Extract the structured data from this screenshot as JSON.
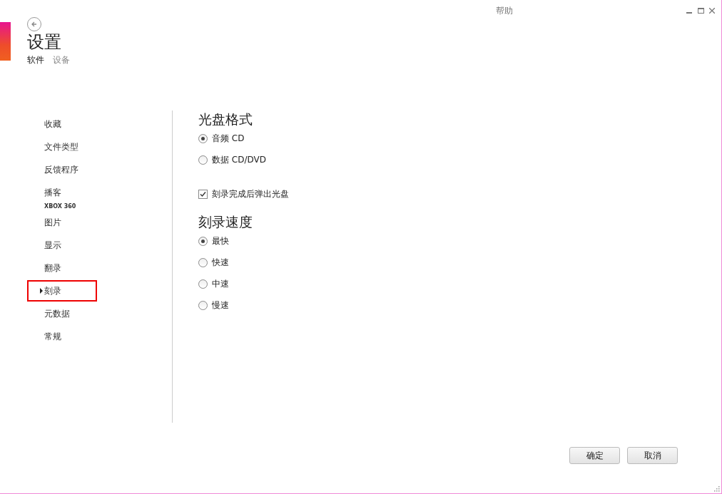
{
  "window": {
    "help": "帮助"
  },
  "header": {
    "title": "设置",
    "tabs": [
      {
        "label": "软件",
        "selected": true
      },
      {
        "label": "设备",
        "selected": false
      }
    ]
  },
  "sidebar": {
    "items": [
      {
        "kind": "item",
        "label": "收藏",
        "selected": false
      },
      {
        "kind": "item",
        "label": "文件类型",
        "selected": false
      },
      {
        "kind": "item",
        "label": "反馈程序",
        "selected": false
      },
      {
        "kind": "item",
        "label": "播客",
        "selected": false
      },
      {
        "kind": "heading",
        "label": "XBOX 360"
      },
      {
        "kind": "item",
        "label": "图片",
        "selected": false
      },
      {
        "kind": "item",
        "label": "显示",
        "selected": false
      },
      {
        "kind": "item",
        "label": "翻录",
        "selected": false
      },
      {
        "kind": "item",
        "label": "刻录",
        "selected": true
      },
      {
        "kind": "item",
        "label": "元数据",
        "selected": false
      },
      {
        "kind": "item",
        "label": "常规",
        "selected": false
      }
    ]
  },
  "sections": [
    {
      "title": "光盘格式",
      "options": [
        {
          "kind": "radio",
          "label": "音频 CD",
          "selected": true
        },
        {
          "kind": "radio",
          "label": "数据 CD/DVD",
          "selected": false
        },
        {
          "kind": "checkbox",
          "label": "刻录完成后弹出光盘",
          "checked": true
        }
      ]
    },
    {
      "title": "刻录速度",
      "options": [
        {
          "kind": "radio",
          "label": "最快",
          "selected": true
        },
        {
          "kind": "radio",
          "label": "快速",
          "selected": false
        },
        {
          "kind": "radio",
          "label": "中速",
          "selected": false
        },
        {
          "kind": "radio",
          "label": "慢速",
          "selected": false
        }
      ]
    }
  ],
  "buttons": [
    "确定",
    "取消"
  ]
}
